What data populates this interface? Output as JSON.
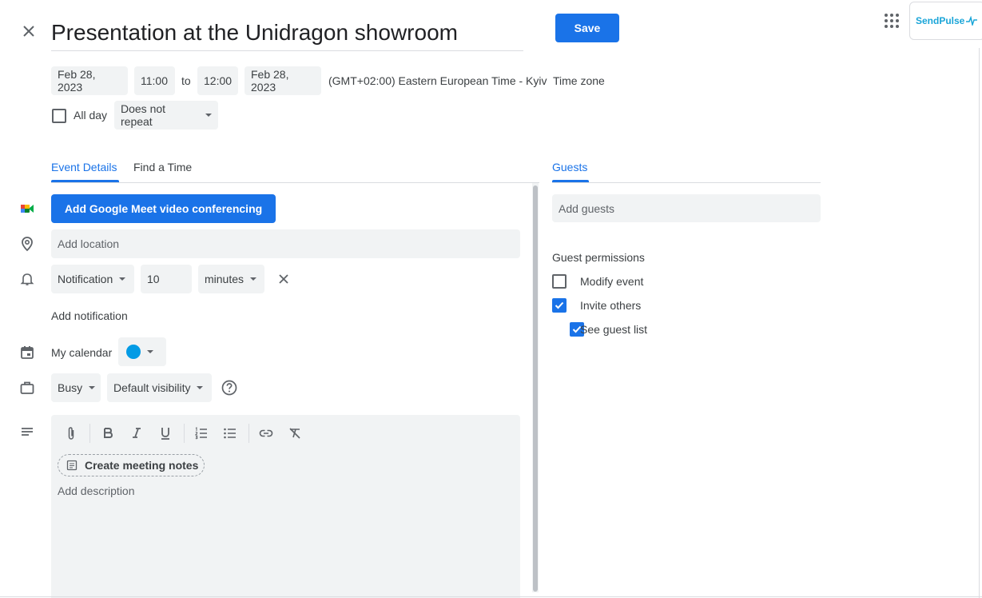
{
  "header": {
    "title": "Presentation at the Unidragon showroom",
    "save_label": "Save",
    "addon_label": "SendPulse"
  },
  "datetime": {
    "start_date": "Feb 28, 2023",
    "start_time": "11:00",
    "to_label": "to",
    "end_time": "12:00",
    "end_date": "Feb 28, 2023",
    "timezone_text": "(GMT+02:00) Eastern European Time - Kyiv",
    "timezone_button": "Time zone",
    "all_day_label": "All day",
    "all_day_checked": false,
    "repeat_value": "Does not repeat"
  },
  "tabs": {
    "details": "Event Details",
    "find_time": "Find a Time",
    "guests": "Guests"
  },
  "details": {
    "meet_button": "Add Google Meet video conferencing",
    "location_placeholder": "Add location",
    "notification_type": "Notification",
    "notification_value": "10",
    "notification_unit": "minutes",
    "add_notification": "Add notification",
    "calendar_name": "My calendar",
    "calendar_color": "#039be5",
    "availability": "Busy",
    "visibility": "Default visibility",
    "create_notes": "Create meeting notes",
    "description_placeholder": "Add description"
  },
  "guests": {
    "add_placeholder": "Add guests",
    "permissions_title": "Guest permissions",
    "permissions": [
      {
        "label": "Modify event",
        "checked": false
      },
      {
        "label": "Invite others",
        "checked": true
      },
      {
        "label": "See guest list",
        "checked": true
      }
    ]
  },
  "colors": {
    "accent": "#1a73e8",
    "field_bg": "#f1f3f4"
  },
  "icons": {
    "close": "close-icon",
    "apps": "apps-grid-icon",
    "meet": "google-meet-icon",
    "location": "location-pin-icon",
    "notification": "bell-icon",
    "calendar": "calendar-icon",
    "status": "briefcase-icon",
    "description": "notes-lines-icon",
    "help": "help-circle-icon"
  }
}
